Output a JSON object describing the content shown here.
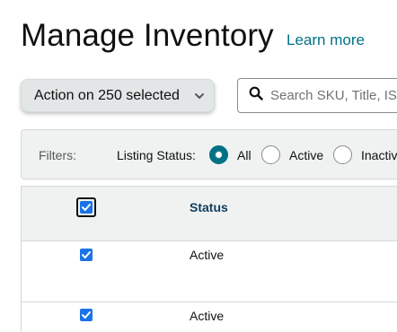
{
  "header": {
    "title": "Manage Inventory",
    "learn_more": "Learn more"
  },
  "toolbar": {
    "action_label": "Action on 250 selected",
    "search_placeholder": "Search SKU, Title, ISBN"
  },
  "filters": {
    "label": "Filters:",
    "listing_status_label": "Listing Status:",
    "options": [
      {
        "label": "All",
        "selected": true
      },
      {
        "label": "Active",
        "selected": false
      },
      {
        "label": "Inactive",
        "selected": false
      }
    ]
  },
  "table": {
    "header_checked": true,
    "columns": [
      "Status"
    ],
    "rows": [
      {
        "checked": true,
        "status": "Active"
      },
      {
        "checked": true,
        "status": "Active"
      }
    ]
  },
  "colors": {
    "link": "#007185",
    "checkbox": "#1a73e8",
    "header_text": "#0f3d5c"
  }
}
